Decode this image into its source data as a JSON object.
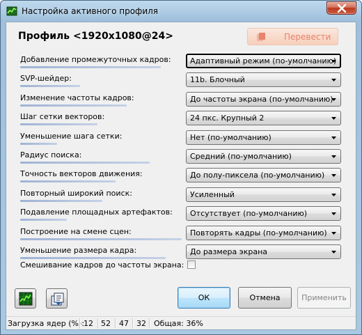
{
  "window": {
    "title": "Настройка активного профиля",
    "icons": {
      "app": "svp-app-icon",
      "close": "close-icon"
    }
  },
  "header": {
    "profile_title": "Профиль <1920x1080@24>",
    "translate_label": "Перевести",
    "translate_icon": "translate-icon",
    "translate_color": "#e8836c"
  },
  "settings": [
    {
      "label": "Добавление промежуточных кадров:",
      "value": "Адаптивный режим (по-умолчанию)",
      "level": 0.87
    },
    {
      "label": "SVP-шейдер:",
      "value": "11b. Блочный",
      "level": 0.37
    },
    {
      "label": "Изменение частоты кадров:",
      "value": "До частоты экрана (по-умолчанию)",
      "level": 0.66
    },
    {
      "label": "Шаг сетки векторов:",
      "value": "24 пкс. Крупный 2",
      "level": 0.48
    },
    {
      "label": "Уменьшение шага сетки:",
      "value": "Нет (по-умолчанию)",
      "level": 0.23
    },
    {
      "label": "Радиус поиска:",
      "value": "Средний (по-умолчанию)",
      "level": 0.8
    },
    {
      "label": "Точность векторов движения:",
      "value": "До полу-пиксела (по-умолчанию)",
      "level": 0.59
    },
    {
      "label": "Повторный широкий поиск:",
      "value": "Усиленный",
      "level": 0.51
    },
    {
      "label": "Подавление площадных артефактов:",
      "value": "Отсутствует (по-умолчанию)",
      "level": 0.29
    },
    {
      "label": "Построение на смене сцен:",
      "value": "Повторять кадры (по-умолчанию)",
      "level": 1.0
    },
    {
      "label": "Уменьшение размера кадра:",
      "value": "До размера экрана",
      "level": 0.9
    }
  ],
  "checkbox_row": {
    "label": "Смешивание кадров до частоты экрана:",
    "checked": false
  },
  "toolbar": {
    "graph_icon": "graph-monitor-icon",
    "copy_icon": "copy-profile-icon"
  },
  "buttons": {
    "ok": "ОК",
    "cancel": "Отмена",
    "apply": "Применить"
  },
  "status": {
    "label": "Загрузка ядер (%):",
    "cores": [
      "12",
      "52",
      "47",
      "32"
    ],
    "total": "Общая: 36%"
  },
  "colors": {
    "bar": "#9fb3d4",
    "accent": "#3c7fb1",
    "close": "#c94a30"
  }
}
